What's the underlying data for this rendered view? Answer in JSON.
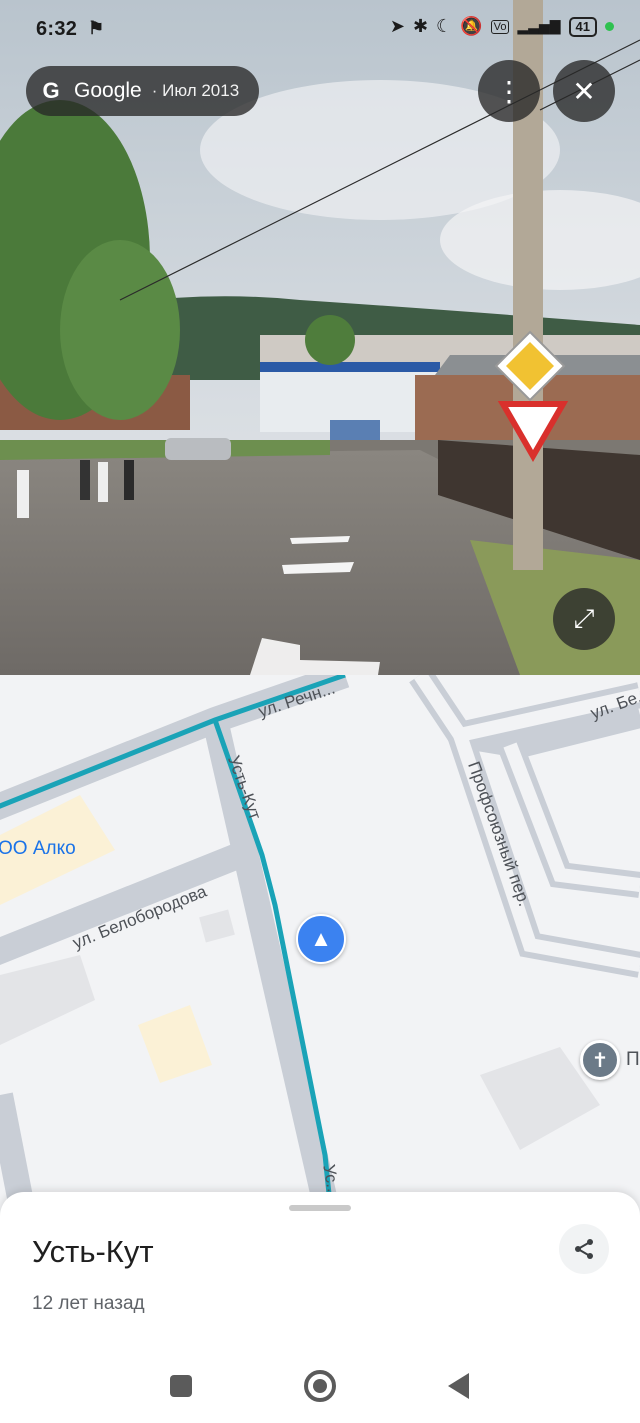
{
  "status_bar": {
    "time": "6:32",
    "battery": "41"
  },
  "street_view": {
    "chip_logo": "G",
    "chip_brand": "Google",
    "chip_date": "· Июл 2013",
    "icons": [
      "more-vert-icon",
      "close-icon",
      "expand-icon"
    ]
  },
  "map": {
    "streets": [
      "ул. Речн...",
      "Усть-Кут",
      "ул. Белобородова",
      "Профсоюзный пер.",
      "ул. Бе...",
      "Ус..."
    ],
    "poi_label": "ОО Алко",
    "pin_label": "П",
    "colors": {
      "route": "#1aa3b7",
      "location": "#3b82f0",
      "map_bg": "#f2f3f5"
    }
  },
  "sheet": {
    "title": "Усть-Кут",
    "subtitle": "12 лет назад"
  }
}
